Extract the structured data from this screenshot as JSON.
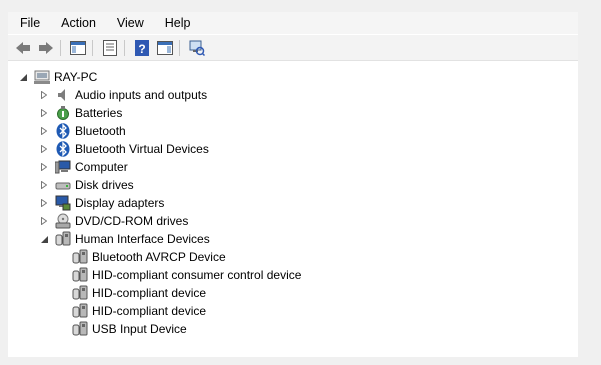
{
  "menu": [
    "File",
    "Action",
    "View",
    "Help"
  ],
  "toolbar": {
    "buttons": [
      "back-icon",
      "forward-icon",
      "show-hide-console-tree-icon",
      "properties-icon",
      "help-icon",
      "show-action-pane-icon",
      "scan-hardware-changes-icon"
    ]
  },
  "tree": {
    "root": "RAY-PC",
    "categories": [
      {
        "label": "Audio inputs and outputs",
        "icon": "speaker-icon",
        "expanded": false
      },
      {
        "label": "Batteries",
        "icon": "battery-icon",
        "expanded": false
      },
      {
        "label": "Bluetooth",
        "icon": "bluetooth-icon",
        "expanded": false
      },
      {
        "label": "Bluetooth Virtual Devices",
        "icon": "bluetooth-icon",
        "expanded": false
      },
      {
        "label": "Computer",
        "icon": "computer-icon",
        "expanded": false
      },
      {
        "label": "Disk drives",
        "icon": "disk-drive-icon",
        "expanded": false
      },
      {
        "label": "Display adapters",
        "icon": "display-adapter-icon",
        "expanded": false
      },
      {
        "label": "DVD/CD-ROM drives",
        "icon": "dvd-drive-icon",
        "expanded": false
      },
      {
        "label": "Human Interface Devices",
        "icon": "hid-icon",
        "expanded": true
      }
    ],
    "hid_children": [
      "Bluetooth AVRCP Device",
      "HID-compliant consumer control device",
      "HID-compliant device",
      "HID-compliant device",
      "USB Input Device"
    ]
  },
  "colors": {
    "background": "#ffffff",
    "chrome": "#f0f0f0",
    "bluetooth": "#1f5ab4"
  }
}
